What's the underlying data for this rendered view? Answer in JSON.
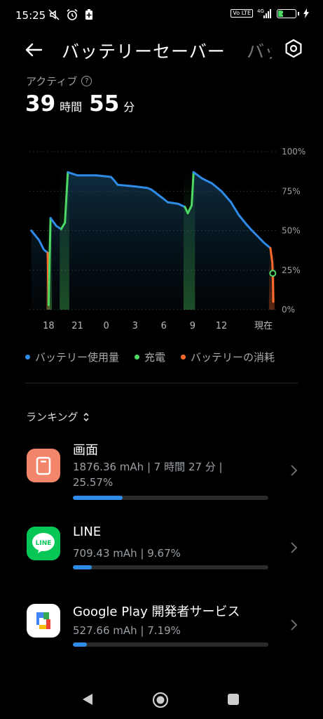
{
  "status_bar": {
    "time": "15:25",
    "volte": "Vo LTE",
    "network": "4G",
    "battery_percent": "27"
  },
  "header": {
    "title": "バッテリーセーバー",
    "next_tab_partial": "バッ"
  },
  "summary": {
    "label": "アクティブ",
    "hours": "39",
    "hours_unit": "時間",
    "minutes": "55",
    "minutes_unit": "分"
  },
  "chart_data": {
    "type": "area",
    "y_ticks": [
      "100%",
      "75%",
      "50%",
      "25%",
      "0%"
    ],
    "x_ticks": [
      "18",
      "21",
      "0",
      "3",
      "6",
      "9",
      "12",
      "現在"
    ],
    "ylim": [
      0,
      100
    ],
    "series": [
      {
        "name": "バッテリー使用量",
        "color": "#2e8be8",
        "points": [
          [
            16.2,
            50
          ],
          [
            17.0,
            44
          ],
          [
            17.5,
            38
          ],
          [
            17.9,
            36
          ]
        ]
      },
      {
        "name": "バッテリーの消耗",
        "color": "#ff6b2c",
        "points": [
          [
            17.9,
            36
          ],
          [
            18.0,
            3
          ]
        ]
      },
      {
        "name": "充電",
        "color": "#4cd964",
        "points": [
          [
            18.0,
            3
          ],
          [
            18.2,
            58
          ]
        ]
      },
      {
        "name": "バッテリー使用量",
        "color": "#2e8be8",
        "points": [
          [
            18.2,
            58
          ],
          [
            18.8,
            53
          ],
          [
            19.3,
            51
          ]
        ]
      },
      {
        "name": "充電",
        "color": "#4cd964",
        "points": [
          [
            19.3,
            51
          ],
          [
            19.7,
            55
          ],
          [
            20.0,
            87
          ]
        ]
      },
      {
        "name": "バッテリー使用量",
        "color": "#2e8be8",
        "points": [
          [
            20.0,
            87
          ],
          [
            21.0,
            85
          ],
          [
            23.0,
            85
          ],
          [
            24.5,
            84
          ],
          [
            24.8,
            82
          ],
          [
            25.2,
            79
          ],
          [
            27.0,
            78
          ],
          [
            28.3,
            77
          ],
          [
            28.7,
            76
          ],
          [
            30.0,
            70
          ],
          [
            30.4,
            68
          ],
          [
            31.5,
            67
          ],
          [
            32.2,
            65
          ]
        ]
      },
      {
        "name": "充電",
        "color": "#4cd964",
        "points": [
          [
            32.2,
            65
          ],
          [
            32.5,
            61
          ],
          [
            32.9,
            66
          ],
          [
            33.1,
            87
          ]
        ]
      },
      {
        "name": "バッテリー使用量",
        "color": "#2e8be8",
        "points": [
          [
            33.1,
            87
          ],
          [
            34.0,
            83
          ],
          [
            35.0,
            80
          ],
          [
            36.0,
            75
          ],
          [
            37.0,
            68
          ],
          [
            37.8,
            60
          ],
          [
            38.6,
            54
          ],
          [
            39.2,
            50
          ],
          [
            40.5,
            42
          ],
          [
            41.1,
            39
          ]
        ]
      },
      {
        "name": "バッテリーの消耗",
        "color": "#ff6b2c",
        "points": [
          [
            41.1,
            39
          ],
          [
            41.3,
            30
          ],
          [
            41.35,
            23
          ],
          [
            41.4,
            5
          ]
        ]
      }
    ],
    "current_marker": {
      "x": 41.35,
      "y": 23
    }
  },
  "legend": [
    {
      "label": "バッテリー使用量",
      "color": "#2e8be8"
    },
    {
      "label": "充電",
      "color": "#4cd964"
    },
    {
      "label": "バッテリーの消耗",
      "color": "#ff6b2c"
    }
  ],
  "ranking": {
    "title": "ランキング",
    "apps": [
      {
        "name": "画面",
        "detail": "1876.36 mAh | 7 時間 27 分 | 25.57%",
        "fraction": 0.2557,
        "icon": "screen-icon"
      },
      {
        "name": "LINE",
        "detail": "709.43 mAh | 9.67%",
        "fraction": 0.0967,
        "icon": "line-app-icon"
      },
      {
        "name": "Google Play 開発者サービス",
        "detail": "527.66 mAh | 7.19%",
        "fraction": 0.0719,
        "icon": "google-play-services-icon"
      }
    ]
  }
}
